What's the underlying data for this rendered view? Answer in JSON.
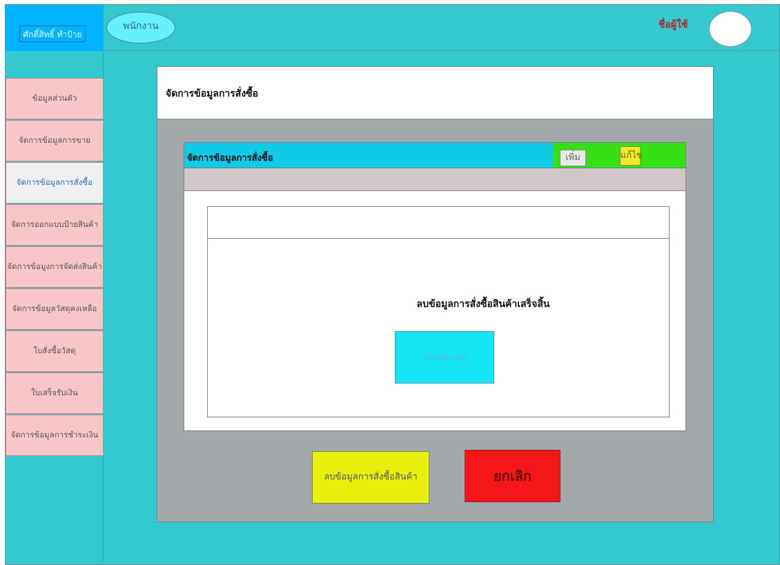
{
  "header": {
    "brand": "ศักดิ์สิทธิ์ ทำป้าย",
    "role": "พนักงาน",
    "username": "ชื่อผู้ใช้"
  },
  "sidebar": {
    "items": [
      {
        "label": "ข้อมูลส่วนตัว",
        "active": false
      },
      {
        "label": "จัดการข้อมูลการขาย",
        "active": false
      },
      {
        "label": "จัดการข้อมูลการสั่งซื้อ",
        "active": true
      },
      {
        "label": "จัดการออกแบบป้ายสินค้า",
        "active": false
      },
      {
        "label": "จัดการข้อมูงการจัดส่งสินค้า",
        "active": false
      },
      {
        "label": "จัดการข้อมูลวัสดุคงเหลือ",
        "active": false
      },
      {
        "label": "ใบสั่งซื้อวัสดุ",
        "active": false
      },
      {
        "label": "ใบเสร็จรับเงิน",
        "active": false
      },
      {
        "label": "จัดการข้อมูลการชำระเงิน",
        "active": false
      }
    ]
  },
  "panel": {
    "title": "จัดการข้อมูลการสั่งซื้อ",
    "section_title": "จัดการข้อมูลการสั่งซื้อ",
    "add_label": "เพิ่ม",
    "edit_label": "แก้ไข"
  },
  "dialog": {
    "message": "ลบข้อมูลการสั่งซื้อสินค้าเสร็จสิ้น",
    "home_label": "กลับหน้าหลัก"
  },
  "actions": {
    "delete_label": "ลบข้อมูลการสั่งซื้อสินค้า",
    "cancel_label": "ยกเลิก"
  },
  "colors": {
    "background": "#33c9cf",
    "brand": "#00b3ff",
    "sidebar_item": "#f8c6c8",
    "active_item": "#f0f0f0",
    "delete_button": "#e8f00c",
    "cancel_button": "#f5161a"
  }
}
